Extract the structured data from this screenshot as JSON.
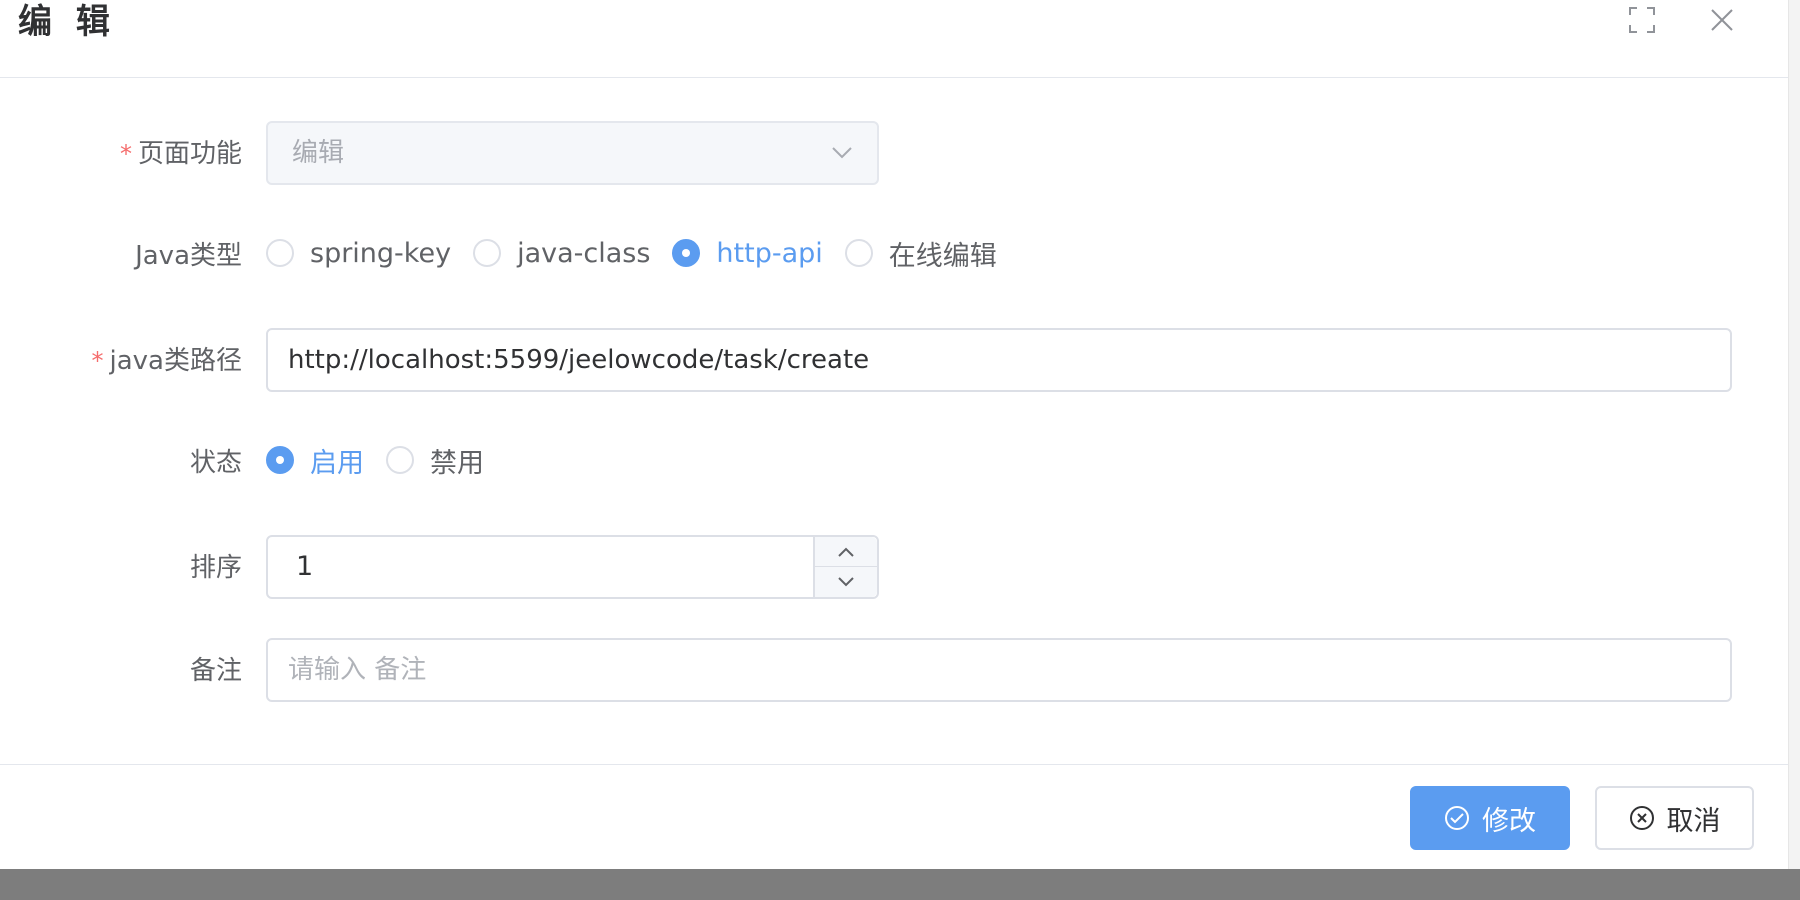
{
  "dialog": {
    "title": "编 辑",
    "maximize_icon": "fullscreen-icon",
    "close_icon": "close-icon"
  },
  "form": {
    "page_function": {
      "label": "页面功能",
      "required_mark": "*",
      "value": "编辑"
    },
    "java_type": {
      "label": "Java类型",
      "options": [
        {
          "label": "spring-key",
          "checked": false
        },
        {
          "label": "java-class",
          "checked": false
        },
        {
          "label": "http-api",
          "checked": true
        },
        {
          "label": "在线编辑",
          "checked": false
        }
      ]
    },
    "java_path": {
      "label": "java类路径",
      "required_mark": "*",
      "value": "http://localhost:5599/jeelowcode/task/create"
    },
    "status": {
      "label": "状态",
      "options": [
        {
          "label": "启用",
          "checked": true
        },
        {
          "label": "禁用",
          "checked": false
        }
      ]
    },
    "sort": {
      "label": "排序",
      "value": "1"
    },
    "remark": {
      "label": "备注",
      "placeholder": "请输入 备注",
      "value": ""
    }
  },
  "footer": {
    "submit_label": "修改",
    "cancel_label": "取消"
  },
  "colors": {
    "primary": "#5b9cf0",
    "required": "#f56c6c"
  }
}
